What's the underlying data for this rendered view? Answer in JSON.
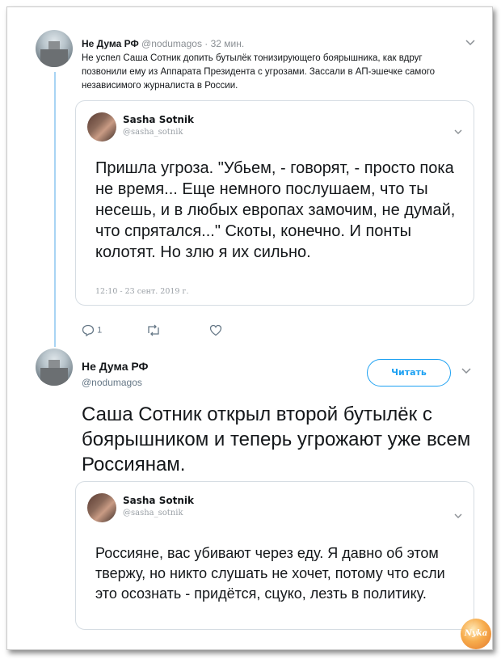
{
  "tweet1": {
    "name": "Не Дума РФ",
    "handle": "@nodumagos",
    "time": "· 32 мин.",
    "text": "Не успел Саша Сотник допить бутылёк тонизирующего боярышника, как вдруг позвонили ему из Аппарата Президента с угрозами. Зассали в АП-эшечке самого независимого журналиста в России.",
    "quote": {
      "name": "Sasha Sotnik",
      "handle": "@sasha_sotnik",
      "text": "Пришла угроза. \"Убьем, - говорят, - просто пока не время... Еще немного послушаем, что ты несешь, и в любых европах замочим, не думай, что спрятался...\" Скоты, конечно. И понты колотят. Но злю я их сильно.",
      "timestamp": "12:10 - 23 сент. 2019 г."
    },
    "actions": {
      "reply_count": "1",
      "retweet_count": "",
      "like_count": ""
    }
  },
  "tweet2": {
    "name": "Не Дума РФ",
    "handle": "@nodumagos",
    "follow_label": "Читать",
    "text": "Саша Сотник открыл второй бутылёк с боярышником и теперь угрожают уже всем Россиянам.",
    "quote": {
      "name": "Sasha Sotnik",
      "handle": "@sasha_sotnik",
      "text": "Россияне, вас убивают через еду. Я давно об этом твержу, но никто слушать не хочет, потому что если это осознать - придётся, сцуко, лезть в политику."
    }
  },
  "watermark": {
    "text": "Nyka"
  },
  "colors": {
    "accent": "#1da1f2",
    "thread_line": "#a8d4f4",
    "muted": "#657786"
  },
  "icons": [
    "reply-icon",
    "retweet-icon",
    "like-icon",
    "chevron-down-icon"
  ]
}
